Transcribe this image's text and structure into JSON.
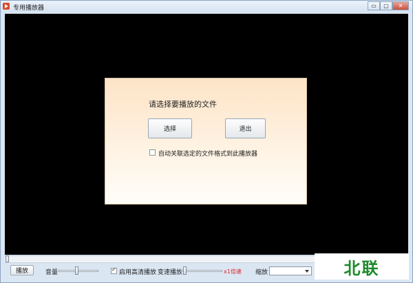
{
  "window": {
    "title": "专用播放器",
    "buttons": {
      "minimize": "▭",
      "maximize": "▢",
      "close": "✕"
    }
  },
  "dialog": {
    "prompt": "请选择要播放的文件",
    "select_label": "选择",
    "exit_label": "退出",
    "associate_label": "自动关联选定的文件格式到此播放器",
    "associate_checked": false
  },
  "controls": {
    "play_label": "播放",
    "volume_label": "音量",
    "volume_level": 0.45,
    "hd_label": "启用高清播放",
    "hd_checked": true,
    "speed_label": "变速播放",
    "speed_level": 0.05,
    "speed_value": "x1倍速",
    "zoom_label": "缩放",
    "zoom_value": ""
  },
  "watermark": {
    "text": "北联"
  },
  "colors": {
    "accent_red": "#e02020",
    "watermark_green": "#1d8a2c",
    "video_bg": "#000000"
  },
  "icons": [
    "app-player-icon",
    "minimize-icon",
    "maximize-icon",
    "close-icon",
    "chevron-down-icon",
    "checkmark-icon"
  ]
}
